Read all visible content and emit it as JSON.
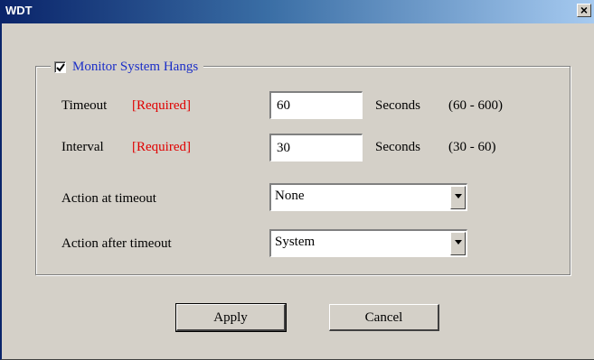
{
  "window": {
    "title": "WDT",
    "close_label": "×"
  },
  "group": {
    "label": "Monitor System Hangs",
    "checked": true
  },
  "timeout": {
    "label": "Timeout",
    "required": "[Required]",
    "value": "60",
    "unit": "Seconds",
    "range": "(60 - 600)"
  },
  "interval": {
    "label": "Interval",
    "required": "[Required]",
    "value": "30",
    "unit": "Seconds",
    "range": "(30 - 60)"
  },
  "action_at_timeout": {
    "label": "Action at timeout",
    "selected": "None"
  },
  "action_after_timeout": {
    "label": "Action after timeout",
    "selected": "System"
  },
  "buttons": {
    "apply": "Apply",
    "cancel": "Cancel"
  },
  "colors": {
    "title_gradient_start": "#0a246a",
    "title_gradient_end": "#a6caf0",
    "dialog_bg": "#d4d0c8",
    "legend_text": "#1c2fc8",
    "required_text": "#e00000"
  }
}
